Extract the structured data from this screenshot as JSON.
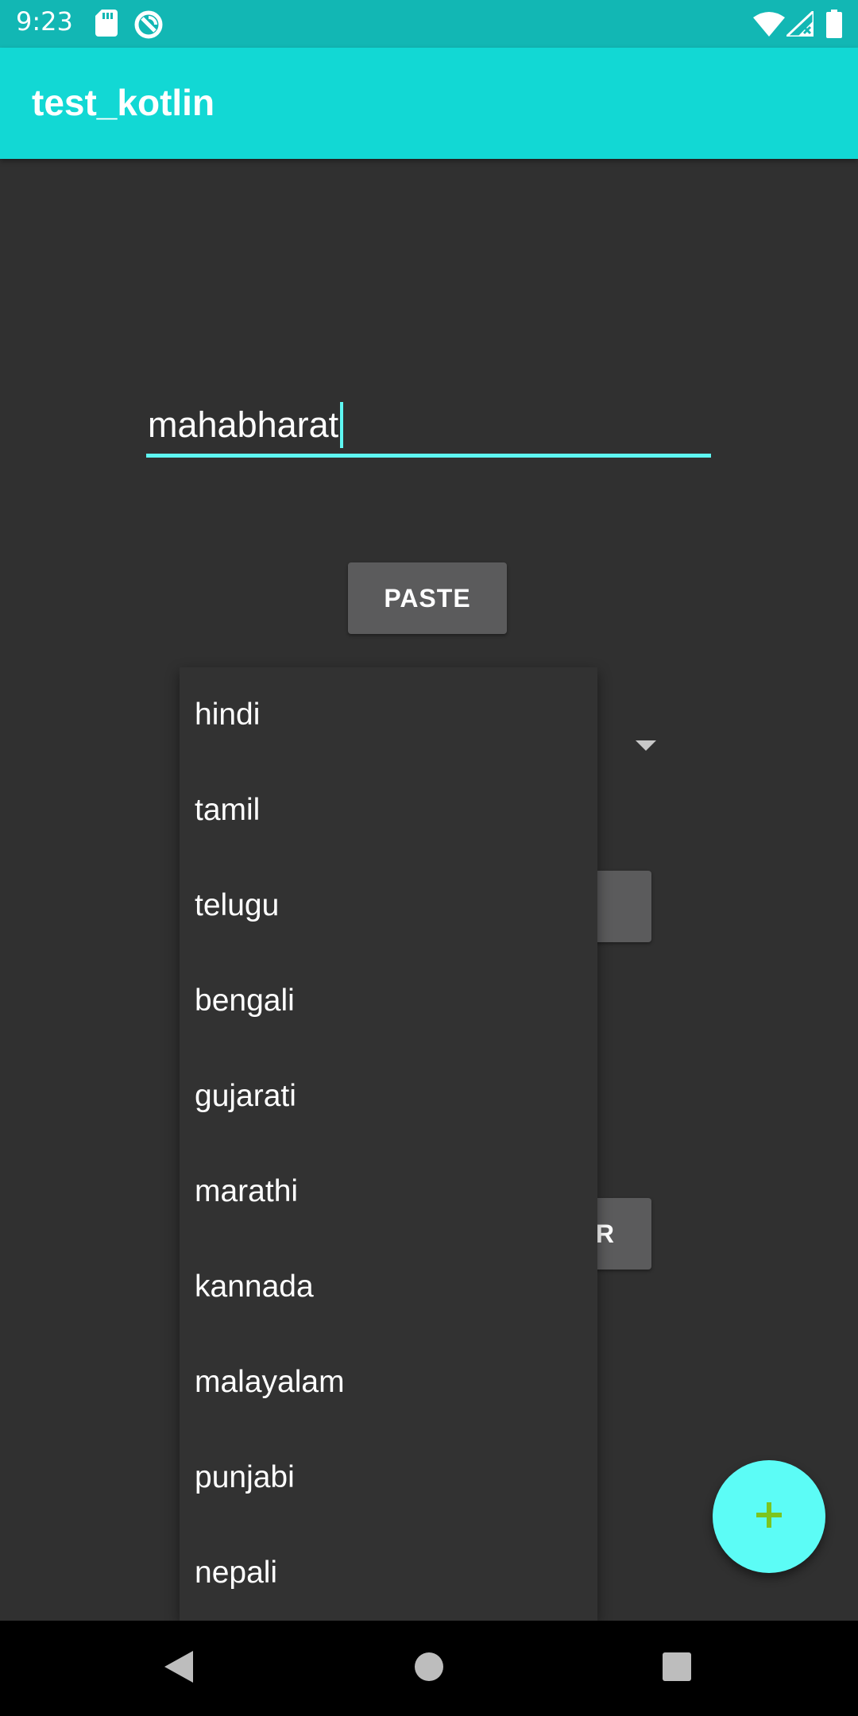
{
  "status_bar": {
    "time": "9:23",
    "icons": [
      "sd-card-icon",
      "sync-circle-icon",
      "wifi-icon",
      "signal-icon",
      "battery-icon"
    ]
  },
  "app_bar": {
    "title": "test_kotlin"
  },
  "input": {
    "value": "mahabharat",
    "accent_color": "#5ef7f2"
  },
  "buttons": {
    "paste_label": "PASTE",
    "partial_button_label": "R"
  },
  "dropdown": {
    "options": [
      "hindi",
      "tamil",
      "telugu",
      "bengali",
      "gujarati",
      "marathi",
      "kannada",
      "malayalam",
      "punjabi",
      "nepali"
    ]
  },
  "fab": {
    "icon": "plus-icon",
    "color": "#5cfcf6",
    "icon_color": "#7cc51f"
  },
  "colors": {
    "status_bar": "#12b7b4",
    "app_bar": "#12d8d4",
    "background": "#303030"
  },
  "nav_bar": {
    "icons": [
      "back-icon",
      "home-icon",
      "recents-icon"
    ]
  }
}
